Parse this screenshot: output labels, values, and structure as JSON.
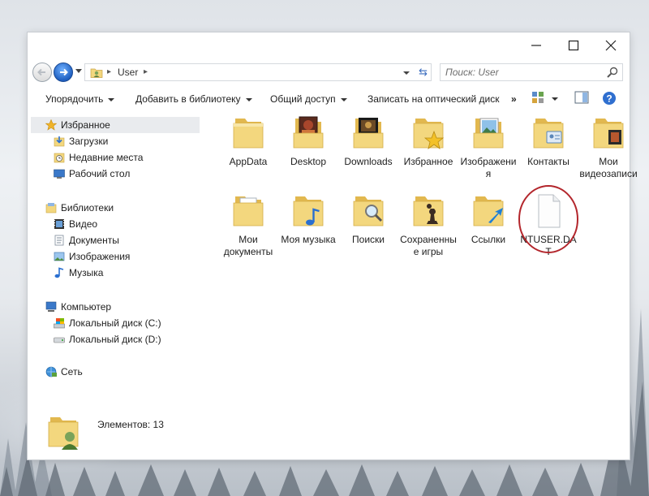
{
  "window": {
    "path_crumbs": [
      "User"
    ]
  },
  "search": {
    "placeholder": "Поиск: User"
  },
  "toolbar": {
    "organize": "Упорядочить",
    "add_to_library": "Добавить в библиотеку",
    "share": "Общий доступ",
    "burn": "Записать на оптический диск",
    "more": "»"
  },
  "sidebar": {
    "favorites": {
      "header": "Избранное",
      "items": [
        "Загрузки",
        "Недавние места",
        "Рабочий стол"
      ]
    },
    "libraries": {
      "header": "Библиотеки",
      "items": [
        "Видео",
        "Документы",
        "Изображения",
        "Музыка"
      ]
    },
    "computer": {
      "header": "Компьютер",
      "items": [
        "Локальный диск (C:)",
        "Локальный диск (D:)"
      ]
    },
    "network": {
      "header": "Сеть"
    }
  },
  "files": [
    {
      "name": "AppData",
      "icon": "folder-icon"
    },
    {
      "name": "Desktop",
      "icon": "desktop-folder-icon"
    },
    {
      "name": "Downloads",
      "icon": "downloads-folder-icon"
    },
    {
      "name": "Избранное",
      "icon": "favorites-folder-icon"
    },
    {
      "name": "Изображения",
      "icon": "pictures-folder-icon"
    },
    {
      "name": "Контакты",
      "icon": "contacts-folder-icon"
    },
    {
      "name": "Мои видеозаписи",
      "icon": "videos-folder-icon"
    },
    {
      "name": "Мои документы",
      "icon": "documents-folder-icon"
    },
    {
      "name": "Моя музыка",
      "icon": "music-folder-icon"
    },
    {
      "name": "Поиски",
      "icon": "searches-folder-icon"
    },
    {
      "name": "Сохраненные игры",
      "icon": "saved-games-folder-icon"
    },
    {
      "name": "Ссылки",
      "icon": "links-folder-icon"
    },
    {
      "name": "NTUSER.DAT",
      "icon": "file-icon",
      "highlighted": true
    }
  ],
  "status": {
    "count_text": "Элементов: 13"
  },
  "colors": {
    "folder": "#f3d77e",
    "folder_dark": "#e2b84f",
    "highlight_circle": "#b3262c",
    "selected_nav": "#e9ebee",
    "accent_blue": "#1f5fc0"
  }
}
